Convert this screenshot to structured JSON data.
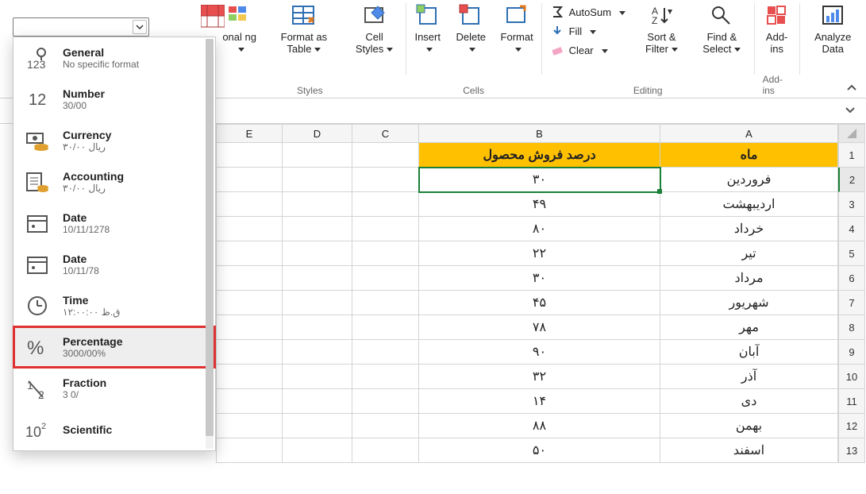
{
  "ribbon": {
    "styles": {
      "cond": "onal\nng",
      "fmtTable": "Format as\nTable",
      "cellStyles": "Cell\nStyles",
      "groupLabel": "Styles"
    },
    "cells": {
      "insert": "Insert",
      "delete": "Delete",
      "format": "Format",
      "groupLabel": "Cells"
    },
    "editing": {
      "autosum": "AutoSum",
      "fill": "Fill",
      "clear": "Clear",
      "sort": "Sort &\nFilter",
      "find": "Find &\nSelect",
      "groupLabel": "Editing"
    },
    "addins": {
      "label": "Add-ins",
      "groupLabel": "Add-ins"
    },
    "analyze": {
      "label": "Analyze\nData"
    }
  },
  "dropdown": [
    {
      "title": "General",
      "sub": "No specific format",
      "icon": "general"
    },
    {
      "title": "Number",
      "sub": "30/00",
      "icon": "number"
    },
    {
      "title": "Currency",
      "sub": "۳۰/۰۰ ريال",
      "icon": "currency"
    },
    {
      "title": "Accounting",
      "sub": "۳۰/۰۰ ريال",
      "icon": "accounting"
    },
    {
      "title": "Date",
      "sub": "10/11/1278",
      "icon": "date"
    },
    {
      "title": "Date",
      "sub": "10/11/78",
      "icon": "date"
    },
    {
      "title": "Time",
      "sub": "۱۲:۰۰:۰۰ ق.ظ",
      "icon": "time"
    },
    {
      "title": "Percentage",
      "sub": "3000/00%",
      "icon": "percent",
      "highlight": true
    },
    {
      "title": "Fraction",
      "sub": "3 0/",
      "icon": "fraction"
    },
    {
      "title": "Scientific",
      "sub": "",
      "icon": "scientific"
    }
  ],
  "grid": {
    "columns": [
      "E",
      "D",
      "C",
      "B",
      "A"
    ],
    "header": {
      "A": "ماه",
      "B": "درصد فروش محصول"
    },
    "rows": [
      {
        "n": 1,
        "A": "ماه",
        "B": "درصد فروش محصول",
        "isHeader": true
      },
      {
        "n": 2,
        "A": "فروردین",
        "B": "۳۰",
        "selected": true
      },
      {
        "n": 3,
        "A": "اردیبهشت",
        "B": "۴۹"
      },
      {
        "n": 4,
        "A": "خرداد",
        "B": "۸۰"
      },
      {
        "n": 5,
        "A": "تیر",
        "B": "۲۲"
      },
      {
        "n": 6,
        "A": "مرداد",
        "B": "۳۰"
      },
      {
        "n": 7,
        "A": "شهریور",
        "B": "۴۵"
      },
      {
        "n": 8,
        "A": "مهر",
        "B": "۷۸"
      },
      {
        "n": 9,
        "A": "آبان",
        "B": "۹۰"
      },
      {
        "n": 10,
        "A": "آذر",
        "B": "۳۲"
      },
      {
        "n": 11,
        "A": "دی",
        "B": "۱۴"
      },
      {
        "n": 12,
        "A": "بهمن",
        "B": "۸۸"
      },
      {
        "n": 13,
        "A": "اسفند",
        "B": "۵۰"
      }
    ]
  },
  "chart_data": {
    "type": "table",
    "title": "درصد فروش محصول per ماه",
    "columns": [
      "ماه",
      "درصد فروش محصول"
    ],
    "categories": [
      "فروردین",
      "اردیبهشت",
      "خرداد",
      "تیر",
      "مرداد",
      "شهریور",
      "مهر",
      "آبان",
      "آذر",
      "دی",
      "بهمن",
      "اسفند"
    ],
    "values": [
      30,
      49,
      80,
      22,
      30,
      45,
      78,
      90,
      32,
      14,
      88,
      50
    ]
  }
}
